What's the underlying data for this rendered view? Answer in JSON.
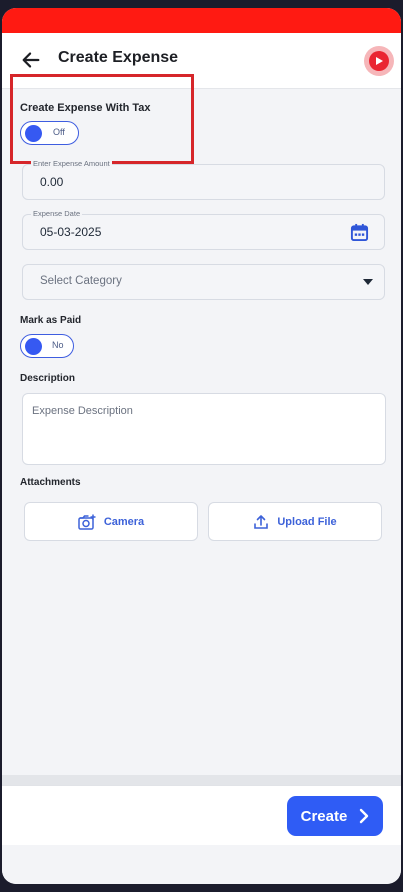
{
  "header": {
    "title": "Create Expense"
  },
  "tax_toggle": {
    "label": "Create Expense With Tax",
    "state": "Off"
  },
  "amount": {
    "label": "Enter Expense Amount",
    "value": "0.00"
  },
  "date": {
    "label": "Expense Date",
    "value": "05-03-2025"
  },
  "category": {
    "placeholder": "Select Category"
  },
  "paid_toggle": {
    "label": "Mark as Paid",
    "state": "No"
  },
  "description": {
    "label": "Description",
    "placeholder": "Expense Description"
  },
  "attachments": {
    "label": "Attachments",
    "camera": "Camera",
    "upload": "Upload File"
  },
  "footer": {
    "create": "Create"
  },
  "colors": {
    "accent": "#2f5cf5",
    "status_bar": "#ff1a12",
    "highlight": "#d6262a"
  }
}
